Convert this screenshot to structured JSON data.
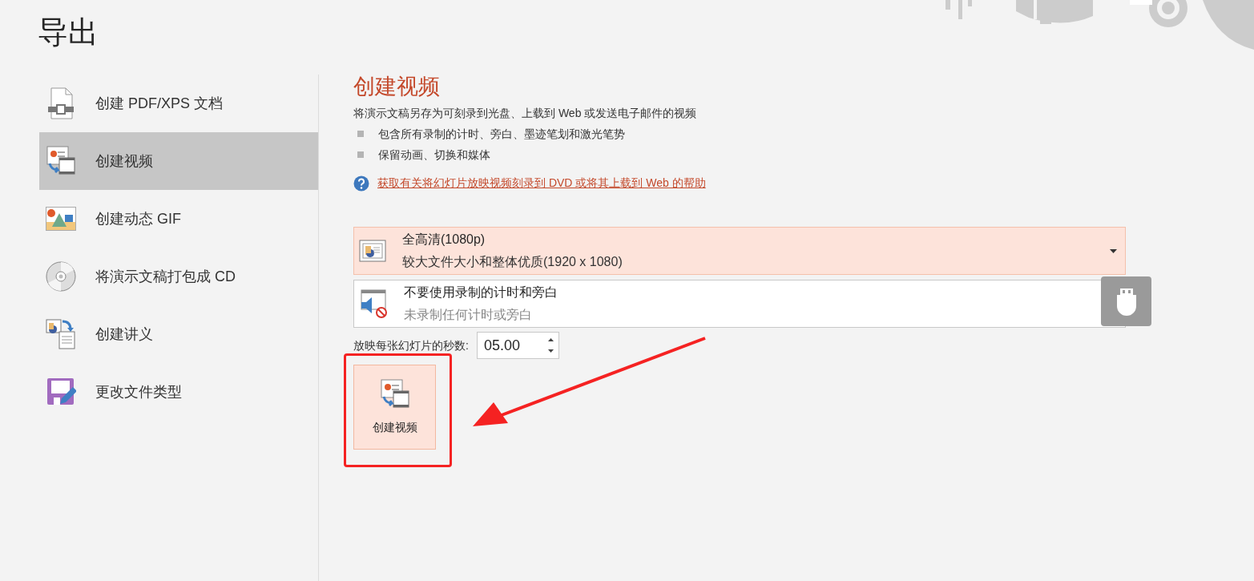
{
  "page_title": "导出",
  "sidebar": {
    "items": [
      {
        "label": "创建 PDF/XPS 文档",
        "kind": "pdf",
        "selected": false
      },
      {
        "label": "创建视频",
        "kind": "video",
        "selected": true
      },
      {
        "label": "创建动态 GIF",
        "kind": "gif",
        "selected": false
      },
      {
        "label": "将演示文稿打包成 CD",
        "kind": "cd",
        "selected": false
      },
      {
        "label": "创建讲义",
        "kind": "handout",
        "selected": false
      },
      {
        "label": "更改文件类型",
        "kind": "filetype",
        "selected": false
      }
    ]
  },
  "content": {
    "heading": "创建视频",
    "description": "将演示文稿另存为可刻录到光盘、上载到 Web 或发送电子邮件的视频",
    "bullets": [
      "包含所有录制的计时、旁白、墨迹笔划和激光笔势",
      "保留动画、切换和媒体"
    ],
    "help_link": "获取有关将幻灯片放映视频刻录到 DVD 或将其上载到 Web 的帮助",
    "quality_dropdown": {
      "title": "全高清(1080p)",
      "subtitle": "较大文件大小和整体优质(1920 x 1080)"
    },
    "narration_dropdown": {
      "title": "不要使用录制的计时和旁白",
      "subtitle": "未录制任何计时或旁白"
    },
    "seconds_label": "放映每张幻灯片的秒数:",
    "seconds_value": "05.00",
    "create_button": "创建视频"
  },
  "annotations": {
    "highlight_frame": true,
    "arrow": true
  }
}
